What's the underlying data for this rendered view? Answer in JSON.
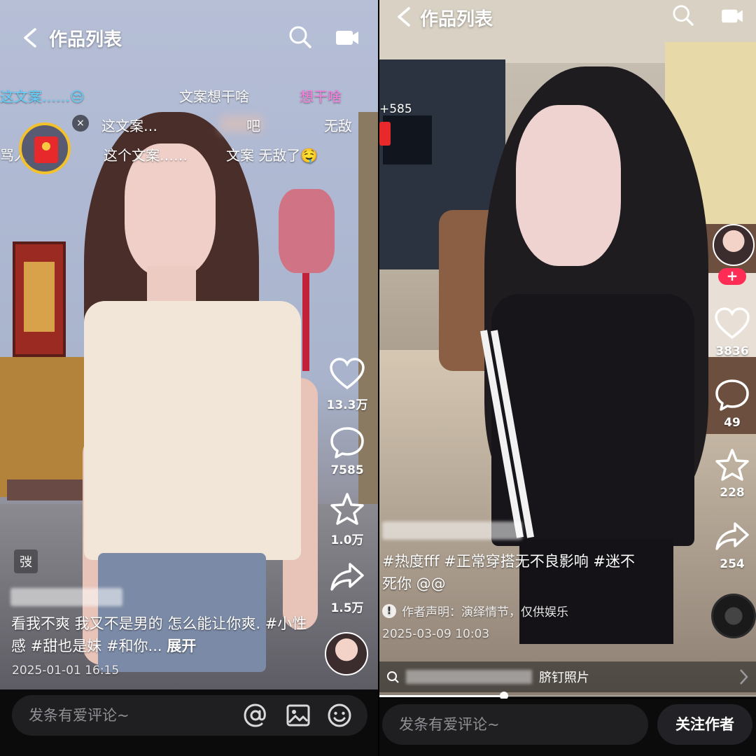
{
  "left_panel": {
    "header": {
      "title": "作品列表"
    },
    "danmaku": [
      "这文案……😒",
      "文案想干啥",
      "想干啥",
      "这文案…",
      "吧",
      "无敌",
      "这个文案……",
      "文案 无敌了🤤"
    ],
    "redpacket_label": "骂人",
    "rail": {
      "likes": "13.3万",
      "comments": "7585",
      "favorites": "1.0万",
      "shares": "1.5万"
    },
    "author_tag": "弢",
    "caption": {
      "text": "看我不爽 我又不是男的 怎么能让你爽. #小性感 #甜也是妹 #和你...",
      "expand": "展开"
    },
    "post_time": "2025-01-01 16:15",
    "bottom": {
      "comment_placeholder": "发条有爱评论~"
    }
  },
  "right_panel": {
    "header": {
      "title": "作品列表"
    },
    "side_counter": "+585",
    "rail": {
      "likes": "3836",
      "comments": "49",
      "favorites": "228",
      "shares": "254"
    },
    "caption": {
      "text": "#热度fff #正常穿搭无不良影响 #迷不死你 @@"
    },
    "disclaimer": "作者声明：演绎情节，仅供娱乐",
    "post_time": "2025-03-09 10:03",
    "related": {
      "text": "脐钉照片"
    },
    "progress": 0.33,
    "bottom": {
      "comment_placeholder": "发条有爱评论~",
      "follow_label": "关注作者"
    }
  },
  "icons": [
    "back-icon",
    "search-icon",
    "video-camera-icon",
    "heart-icon",
    "comment-icon",
    "star-icon",
    "share-icon",
    "at-icon",
    "image-icon",
    "emoji-icon",
    "info-icon",
    "chevron-right-icon",
    "search-mini-icon"
  ],
  "colors": {
    "like_accent": "#ff2c55",
    "redpacket": "#e8292c",
    "danmaku_cyan": "#5fd3ff",
    "danmaku_pink": "#ff7ee0"
  }
}
